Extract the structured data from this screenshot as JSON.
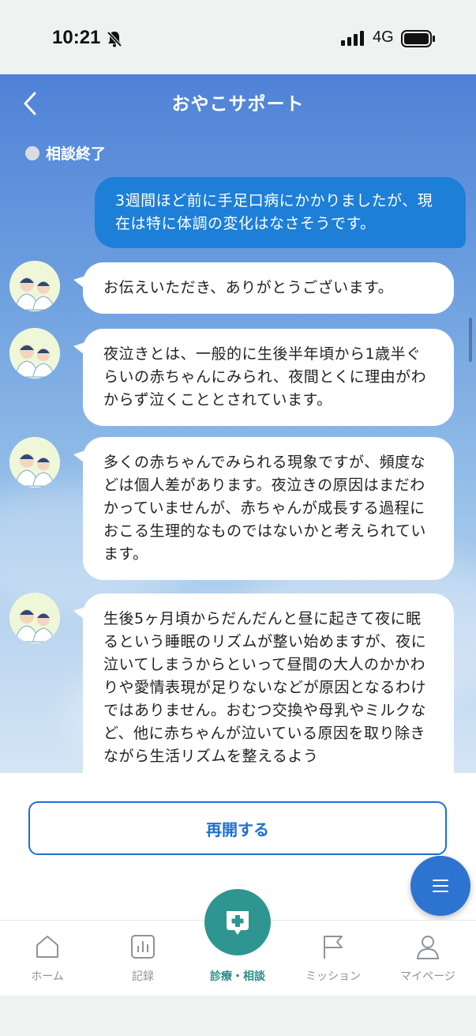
{
  "status_bar": {
    "time": "10:21",
    "network": "4G"
  },
  "header": {
    "title": "おやこサポート"
  },
  "consult_status": {
    "label": "相談終了"
  },
  "messages": [
    {
      "role": "user",
      "text": "3週間ほど前に手足口病にかかりましたが、現在は特に体調の変化はなさそうです。"
    },
    {
      "role": "bot",
      "text": "お伝えいただき、ありがとうございます。"
    },
    {
      "role": "bot",
      "text": "夜泣きとは、一般的に生後半年頃から1歳半ぐらいの赤ちゃんにみられ、夜間とくに理由がわからず泣くこととされています。"
    },
    {
      "role": "bot",
      "text": "多くの赤ちゃんでみられる現象ですが、頻度などは個人差があります。夜泣きの原因はまだわかっていませんが、赤ちゃんが成長する過程におこる生理的なものではないかと考えられています。"
    },
    {
      "role": "bot",
      "text": "生後5ヶ月頃からだんだんと昼に起きて夜に眠るという睡眠のリズムが整い始めますが、夜に泣いてしまうからといって昼間の大人のかかわりや愛情表現が足りないなどが原因となるわけではありません。おむつ交換や母乳やミルクなど、他に赤ちゃんが泣いている原因を取り除きながら生活リズムを整えるよう"
    }
  ],
  "resume_button": {
    "label": "再開する"
  },
  "tabs": [
    {
      "label": "ホーム",
      "icon": "home-icon"
    },
    {
      "label": "記録",
      "icon": "chart-icon"
    },
    {
      "label": "診療・相談",
      "icon": "consult-plus-icon",
      "active": true
    },
    {
      "label": "ミッション",
      "icon": "flag-icon"
    },
    {
      "label": "マイページ",
      "icon": "person-icon"
    }
  ],
  "colors": {
    "user_bubble": "#1d7fd8",
    "accent_teal": "#2f9590",
    "primary_blue": "#1d6fd0"
  }
}
